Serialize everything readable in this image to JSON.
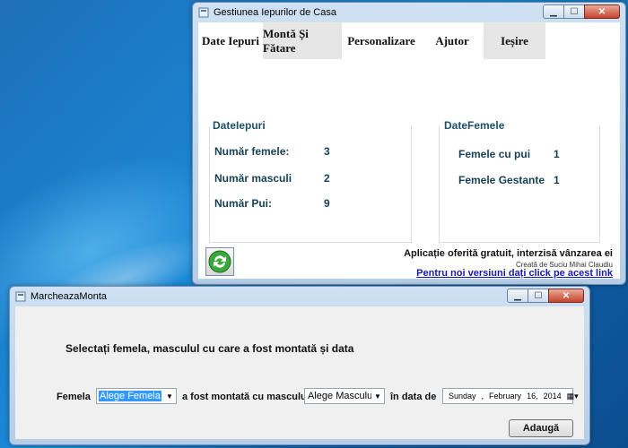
{
  "main_window": {
    "title": "Gestiunea Iepurilor de Casa",
    "tabs": [
      {
        "label": "Date Iepuri",
        "active": false
      },
      {
        "label": "Montă Și Fătare",
        "active": true
      },
      {
        "label": "Personalizare",
        "active": false
      },
      {
        "label": "Ajutor",
        "active": false
      },
      {
        "label": "Ieșire",
        "active": true
      }
    ],
    "group_iepuri": {
      "title": "DateIepuri",
      "rows": [
        {
          "label": "Număr femele:",
          "value": "3"
        },
        {
          "label": "Număr masculi",
          "value": "2"
        },
        {
          "label": "Număr Pui:",
          "value": "9"
        }
      ]
    },
    "group_femele": {
      "title": "DateFemele",
      "rows": [
        {
          "label": "Femele cu pui",
          "value": "1"
        },
        {
          "label": "Femele Gestante",
          "value": "1"
        }
      ]
    },
    "promo_text": "Aplicație oferită gratuit, interzisă vânzarea ei",
    "credit_text": "Creată de Suciu Mihai Claudiu",
    "link_text": "Pentru noi versiuni dați click pe acest link"
  },
  "dialog": {
    "title": "MarcheazaMonta",
    "prompt": "Selectați femela, masculul cu care a fost montată și data",
    "femela_label": "Femela",
    "femela_value": "Alege Femela",
    "mascul_label": "a fost montată cu masculul",
    "mascul_value": "Alege Masculul",
    "date_label": "în data de",
    "date": {
      "weekday": "Sunday",
      "month": "February",
      "day": "16,",
      "year": "2014"
    },
    "add_button": "Adaugă"
  },
  "colors": {
    "accent_group_title": "#1f4f6a",
    "link": "#1a1aa8",
    "selection": "#3399ff"
  }
}
